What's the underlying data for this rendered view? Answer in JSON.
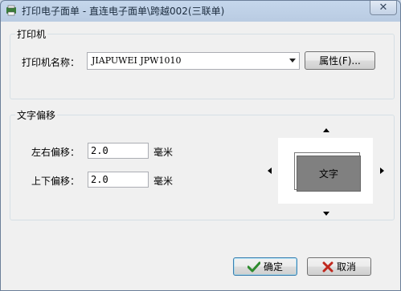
{
  "window": {
    "title": "打印电子面单 - 直连电子面单\\跨越002(三联单)",
    "close_symbol": "✕"
  },
  "printer_group": {
    "title": "打印机",
    "name_label": "打印机名称：",
    "selected_printer": "JIAPUWEI JPW1010",
    "properties_button": "属性(F)..."
  },
  "offset_group": {
    "title": "文字偏移",
    "horizontal_label": "左右偏移：",
    "horizontal_value": "2.0",
    "horizontal_unit": "毫米",
    "vertical_label": "上下偏移：",
    "vertical_value": "2.0",
    "vertical_unit": "毫米",
    "preview_text": "文字"
  },
  "footer": {
    "ok_button": "确定",
    "cancel_button": "取消"
  },
  "colors": {
    "ok_icon": "#2e8b2e",
    "cancel_icon": "#c0281e",
    "preview_block": "#808080"
  }
}
